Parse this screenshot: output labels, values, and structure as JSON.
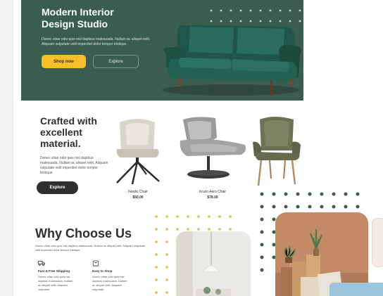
{
  "hero": {
    "title_line1": "Modern Interior",
    "title_line2": "Design Studio",
    "description": "Donec vitae odio quis nisl dapibus malesuada. Nullam ac aliquet velit. Aliquam vulputate velit imperdiet dolor tempor tristique.",
    "shop_now_label": "Shop now",
    "explore_label": "Explore",
    "background_color": "#3b5d50",
    "accent_color": "#f9bf29"
  },
  "products": {
    "title_line1": "Crafted with",
    "title_line2": "excellent",
    "title_line3": "material.",
    "description": "Donec vitae odio quis nisl dapibus malesuada. Nullam ac aliquet velit. Aliquam vulputate velit imperdiet dolor tempor tristique.",
    "explore_label": "Explore",
    "items": [
      {
        "name": "Nordic Chair",
        "price": "$50.00"
      },
      {
        "name": "Kruzo Aero Chair",
        "price": "$78.00"
      },
      {
        "name": "",
        "price": ""
      }
    ]
  },
  "why": {
    "title": "Why Choose Us",
    "description": "Donec vitae odio quis nisl dapibus malesuada. Nullam ac aliquet velit. Aliquam vulputate velit imperdiet dolor tempor tristique.",
    "features": [
      {
        "icon": "truck-icon",
        "title": "Fast & Free Shipping",
        "description": "Donec vitae odio quis nisl dapibus malesuada. Nullam ac aliquet velit. Aliquam vulputate."
      },
      {
        "icon": "bag-icon",
        "title": "Easy to Shop",
        "description": "Donec vitae odio quis nisl dapibus malesuada. Nullam ac aliquet velit. Aliquam vulputate."
      }
    ]
  }
}
